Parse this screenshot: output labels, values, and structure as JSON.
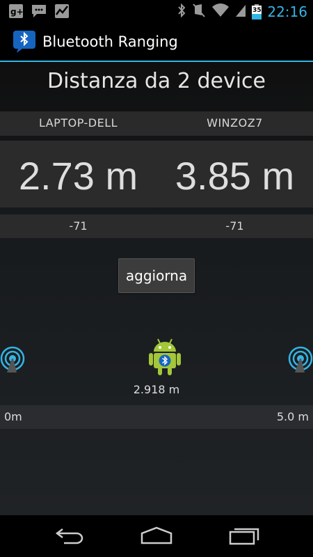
{
  "status_bar": {
    "time": "22:16",
    "battery_level": "35",
    "left_icons": [
      "google-plus-icon",
      "chat-icon",
      "stocks-icon"
    ],
    "right_icons": [
      "bluetooth-icon",
      "mute-icon",
      "wifi-icon",
      "signal-icon",
      "battery-icon"
    ]
  },
  "app": {
    "title": "Bluetooth Ranging"
  },
  "main": {
    "heading": "Distanza da 2 device",
    "devices": [
      {
        "name": "LAPTOP-DELL",
        "distance": "2.73 m",
        "rssi": "-71"
      },
      {
        "name": "WINZOZ7",
        "distance": "3.85 m",
        "rssi": "-71"
      }
    ],
    "refresh_button": "aggiorna",
    "position": {
      "distance_label": "2.918 m",
      "fraction_of_scale": 0.58
    },
    "scale": {
      "min": "0m",
      "max": "5.0 m"
    }
  },
  "colors": {
    "accent": "#33b5e5",
    "android_green": "#a4c639",
    "bluetooth_blue": "#1565c0"
  },
  "nav_bar": {
    "icons": [
      "back-icon",
      "home-icon",
      "recent-apps-icon"
    ]
  }
}
